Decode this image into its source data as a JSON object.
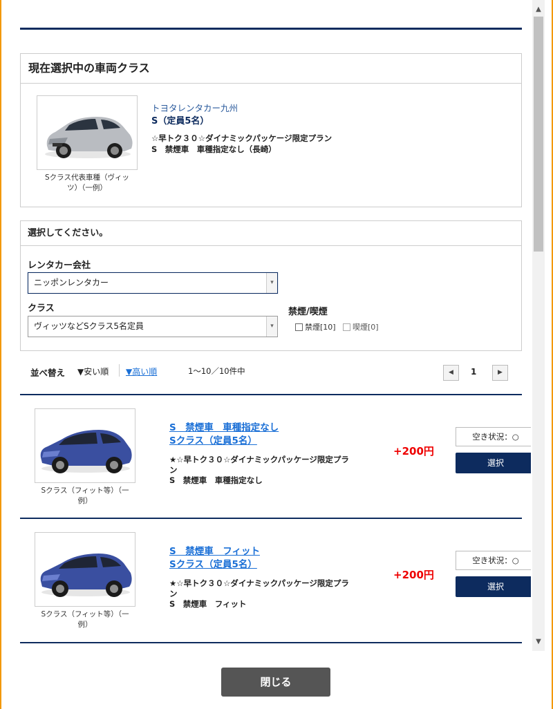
{
  "current": {
    "title": "現在選択中の車両クラス",
    "company": "トヨタレンタカー九州",
    "class_name": "S（定員5名）",
    "plan_line1": "☆早トク３０☆ダイナミックパッケージ限定プラン",
    "plan_line2": "S　禁煙車　車種指定なし（長崎）",
    "image_caption_1": "Sクラス代表車種（ヴィッ",
    "image_caption_2": "ツ）（一例）"
  },
  "selection": {
    "title": "選択してください。",
    "company_label": "レンタカー会社",
    "company_value": "ニッポンレンタカー",
    "class_label": "クラス",
    "class_value": "ヴィッツなどSクラス5名定員",
    "smoke_label": "禁煙/喫煙",
    "nonsmoking": "禁煙[10]",
    "smoking": "喫煙[0]"
  },
  "sort": {
    "label": "並べ替え",
    "cheap": "▼安い順",
    "expensive": "▼高い順",
    "count": "1〜10／10件中",
    "page": "1"
  },
  "items": [
    {
      "name_line1": "S　禁煙車　車種指定なし",
      "name_line2": "Sクラス（定員5名）",
      "desc_line1": "★☆早トク３０☆ダイナミックパッケージ限定プラ",
      "desc_line2": "ン",
      "desc_line3": "S　禁煙車　車種指定なし",
      "price": "+200円",
      "availability": "空き状況：○",
      "select": "選択",
      "caption_1": "Sクラス（フィット等）（一",
      "caption_2": "例）"
    },
    {
      "name_line1": "S　禁煙車　フィット",
      "name_line2": "Sクラス（定員5名）",
      "desc_line1": "★☆早トク３０☆ダイナミックパッケージ限定プラ",
      "desc_line2": "ン",
      "desc_line3": "S　禁煙車　フィット",
      "price": "+200円",
      "availability": "空き状況：○",
      "select": "選択",
      "caption_1": "Sクラス（フィット等）（一",
      "caption_2": "例）"
    }
  ],
  "close_label": "閉じる",
  "colors": {
    "accent": "#0d2b5e",
    "frame": "#f39800",
    "price": "#e00000",
    "link": "#1a6fd6"
  }
}
